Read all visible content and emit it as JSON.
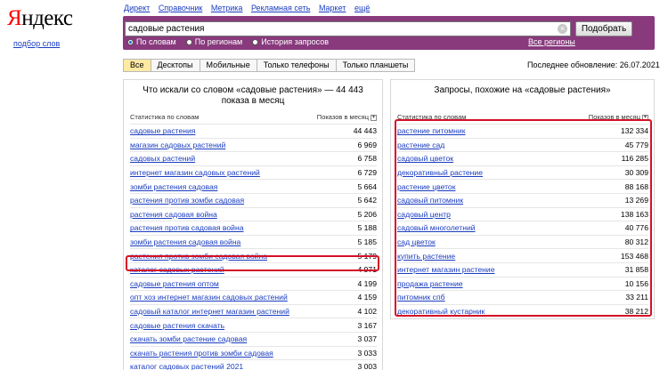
{
  "logo": {
    "first": "Я",
    "rest": "ндекс"
  },
  "subtitle": "подбор слов",
  "topnav": [
    "Директ",
    "Справочник",
    "Метрика",
    "Рекламная сеть",
    "Маркет",
    "ещё"
  ],
  "search": {
    "value": "садовые растения",
    "button": "Подобрать"
  },
  "radios": [
    {
      "label": "По словам",
      "checked": true
    },
    {
      "label": "По регионам",
      "checked": false
    },
    {
      "label": "История запросов",
      "checked": false
    }
  ],
  "all_regions": "Все регионы",
  "tabs": [
    "Все",
    "Десктопы",
    "Мобильные",
    "Только телефоны",
    "Только планшеты"
  ],
  "updated": "Последнее обновление: 26.07.2021",
  "left": {
    "title": "Что искали со словом «садовые растения» — 44 443 показа в месяц",
    "col1": "Статистика по словам",
    "col2": "Показов в месяц",
    "rows": [
      {
        "phrase": "садовые растения",
        "count": "44 443"
      },
      {
        "phrase": "магазин садовых растений",
        "count": "6 969"
      },
      {
        "phrase": "садовых растений",
        "count": "6 758"
      },
      {
        "phrase": "интернет магазин садовых растений",
        "count": "6 729"
      },
      {
        "phrase": "зомби растения садовая",
        "count": "5 664"
      },
      {
        "phrase": "растения против зомби садовая",
        "count": "5 642"
      },
      {
        "phrase": "растения садовая война",
        "count": "5 206"
      },
      {
        "phrase": "растения против садовая война",
        "count": "5 188"
      },
      {
        "phrase": "зомби растения садовая война",
        "count": "5 185"
      },
      {
        "phrase": "растения против зомби садовая война",
        "count": "5 179"
      },
      {
        "phrase": "каталог садовых растений",
        "count": "4 971"
      },
      {
        "phrase": "садовые растения оптом",
        "count": "4 199"
      },
      {
        "phrase": "опт хоз интернет магазин садовых растений",
        "count": "4 159"
      },
      {
        "phrase": "садовый каталог интернет магазин растений",
        "count": "4 102"
      },
      {
        "phrase": "садовые растения скачать",
        "count": "3 167"
      },
      {
        "phrase": "скачать зомби растение садовая",
        "count": "3 037"
      },
      {
        "phrase": "скачать растения против зомби садовая",
        "count": "3 033"
      },
      {
        "phrase": "каталог садовых растений 2021",
        "count": "3 003"
      }
    ]
  },
  "right": {
    "title": "Запросы, похожие на «садовые растения»",
    "col1": "Статистика по словам",
    "col2": "Показов в месяц",
    "rows": [
      {
        "phrase": "растение питомник",
        "count": "132 334"
      },
      {
        "phrase": "растение сад",
        "count": "45 779"
      },
      {
        "phrase": "садовый цветок",
        "count": "116 285"
      },
      {
        "phrase": "декоративный растение",
        "count": "30 309"
      },
      {
        "phrase": "растение цветок",
        "count": "88 168"
      },
      {
        "phrase": "садовый питомник",
        "count": "13 269"
      },
      {
        "phrase": "садовый центр",
        "count": "138 163"
      },
      {
        "phrase": "садовый многолетний",
        "count": "40 776"
      },
      {
        "phrase": "сад цветок",
        "count": "80 312"
      },
      {
        "phrase": "купить растение",
        "count": "153 468"
      },
      {
        "phrase": "интернет магазин растение",
        "count": "31 858"
      },
      {
        "phrase": "продажа растение",
        "count": "10 156"
      },
      {
        "phrase": "питомник спб",
        "count": "33 211"
      },
      {
        "phrase": "декоративный кустарник",
        "count": "38 212"
      }
    ]
  },
  "colors": {
    "header": "#883a7d",
    "link": "#1a3dc1",
    "highlight": "#d41027",
    "logo_red": "#ff0000"
  }
}
